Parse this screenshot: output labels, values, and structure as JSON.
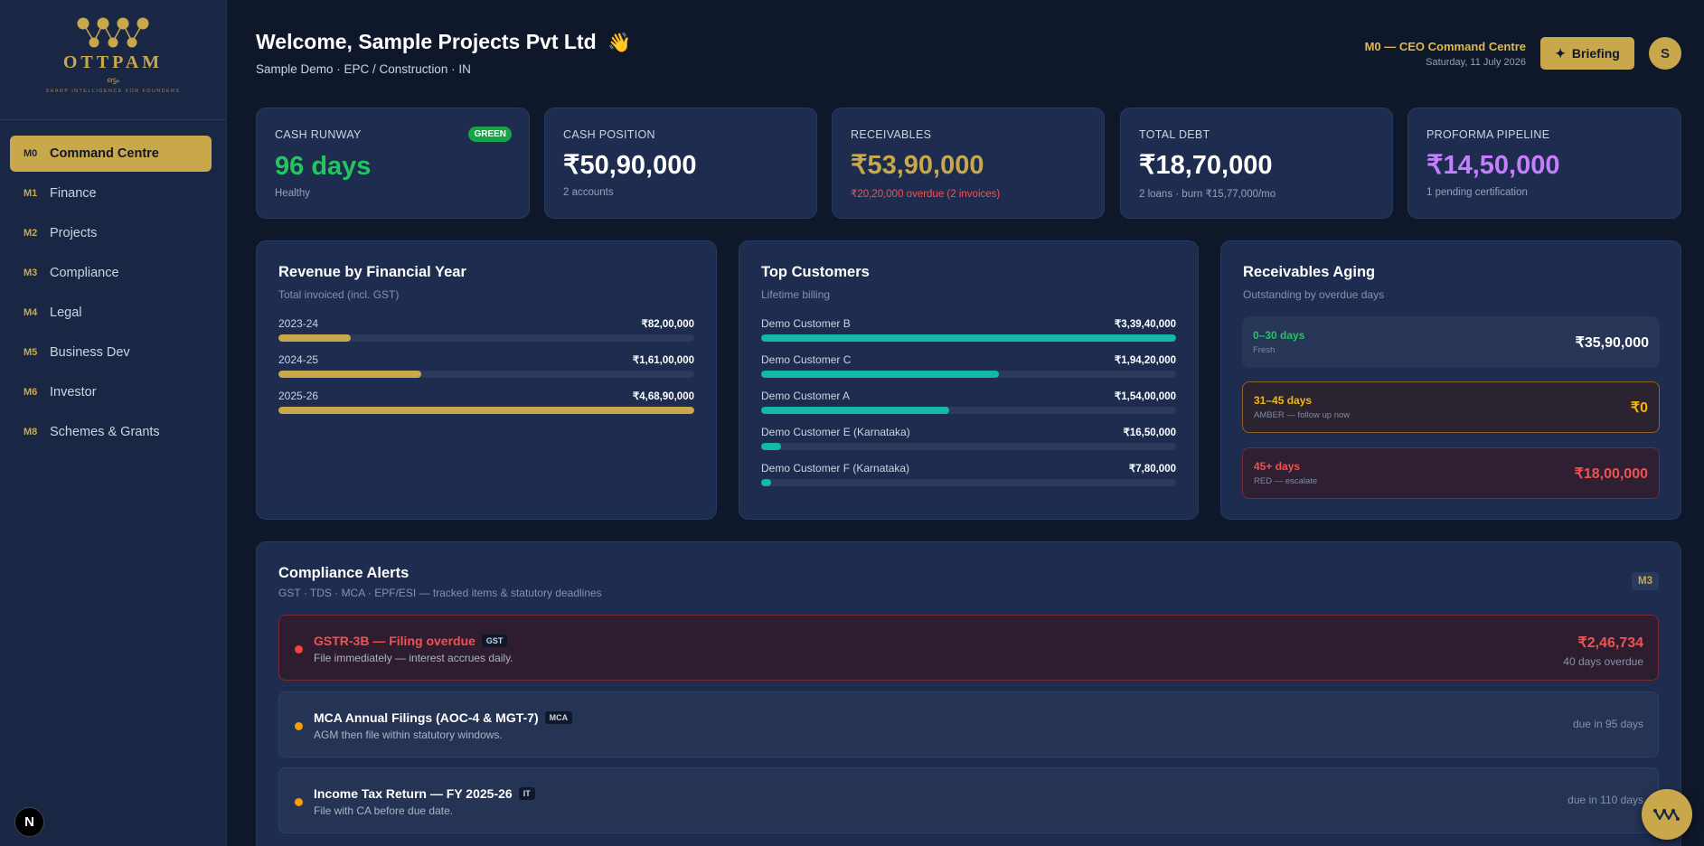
{
  "brand": {
    "name": "OTTPAM",
    "script": "ഒട്ടം",
    "tagline": "SHARP INTELLIGENCE FOR FOUNDERS"
  },
  "sidebar": {
    "items": [
      {
        "code": "M0",
        "label": "Command Centre",
        "active": true
      },
      {
        "code": "M1",
        "label": "Finance"
      },
      {
        "code": "M2",
        "label": "Projects"
      },
      {
        "code": "M3",
        "label": "Compliance"
      },
      {
        "code": "M4",
        "label": "Legal"
      },
      {
        "code": "M5",
        "label": "Business Dev"
      },
      {
        "code": "M6",
        "label": "Investor"
      },
      {
        "code": "M8",
        "label": "Schemes & Grants"
      }
    ],
    "next_badge": "N"
  },
  "header": {
    "title": "Welcome, Sample Projects Pvt Ltd",
    "wave": "👋",
    "subtitle": "Sample Demo · EPC / Construction · IN",
    "command_centre": "M0 — CEO Command Centre",
    "date": "Saturday, 11 July 2026",
    "briefing_label": "Briefing",
    "avatar_initial": "S"
  },
  "kpis": {
    "runway": {
      "label": "CASH RUNWAY",
      "value": "96 days",
      "sub": "Healthy",
      "badge": "GREEN"
    },
    "cash": {
      "label": "CASH POSITION",
      "value": "₹50,90,000",
      "sub": "2 accounts"
    },
    "receivables": {
      "label": "RECEIVABLES",
      "value": "₹53,90,000",
      "sub": "₹20,20,000 overdue (2 invoices)"
    },
    "debt": {
      "label": "TOTAL DEBT",
      "value": "₹18,70,000",
      "sub": "2 loans · burn ₹15,77,000/mo"
    },
    "proforma": {
      "label": "PROFORMA PIPELINE",
      "value": "₹14,50,000",
      "sub": "1 pending certification"
    }
  },
  "revenue": {
    "title": "Revenue by Financial Year",
    "subtitle": "Total invoiced (incl. GST)",
    "rows": [
      {
        "name": "2023-24",
        "value": "₹82,00,000",
        "amount": 8200000
      },
      {
        "name": "2024-25",
        "value": "₹1,61,00,000",
        "amount": 16100000
      },
      {
        "name": "2025-26",
        "value": "₹4,68,90,000",
        "amount": 46890000
      }
    ]
  },
  "customers": {
    "title": "Top Customers",
    "subtitle": "Lifetime billing",
    "rows": [
      {
        "name": "Demo Customer B",
        "value": "₹3,39,40,000",
        "amount": 33940000
      },
      {
        "name": "Demo Customer C",
        "value": "₹1,94,20,000",
        "amount": 19420000
      },
      {
        "name": "Demo Customer A",
        "value": "₹1,54,00,000",
        "amount": 15400000
      },
      {
        "name": "Demo Customer E (Karnataka)",
        "value": "₹16,50,000",
        "amount": 1650000
      },
      {
        "name": "Demo Customer F (Karnataka)",
        "value": "₹7,80,000",
        "amount": 780000
      }
    ]
  },
  "aging": {
    "title": "Receivables Aging",
    "subtitle": "Outstanding by overdue days",
    "buckets": [
      {
        "label": "0–30 days",
        "note": "Fresh",
        "value": "₹35,90,000"
      },
      {
        "label": "31–45 days",
        "note": "AMBER — follow up now",
        "value": "₹0"
      },
      {
        "label": "45+ days",
        "note": "RED — escalate",
        "value": "₹18,00,000"
      }
    ]
  },
  "compliance": {
    "title": "Compliance Alerts",
    "subtitle": "GST · TDS · MCA · EPF/ESI — tracked items & statutory deadlines",
    "tag": "M3",
    "alerts": [
      {
        "title": "GSTR-3B — Filing overdue",
        "tag": "GST",
        "desc": "File immediately — interest accrues daily.",
        "amount": "₹2,46,734",
        "note": "40 days overdue"
      },
      {
        "title": "MCA Annual Filings (AOC-4 & MGT-7)",
        "tag": "MCA",
        "desc": "AGM then file within statutory windows.",
        "due": "due in 95 days"
      },
      {
        "title": "Income Tax Return — FY 2025-26",
        "tag": "IT",
        "desc": "File with CA before due date.",
        "due": "due in 110 days"
      }
    ]
  },
  "colors": {
    "gold": "#c9a84c",
    "green": "#22c55e",
    "amber": "#f59e0b",
    "red": "#f05252",
    "purple": "#c77dff",
    "teal": "#14b8a6"
  }
}
